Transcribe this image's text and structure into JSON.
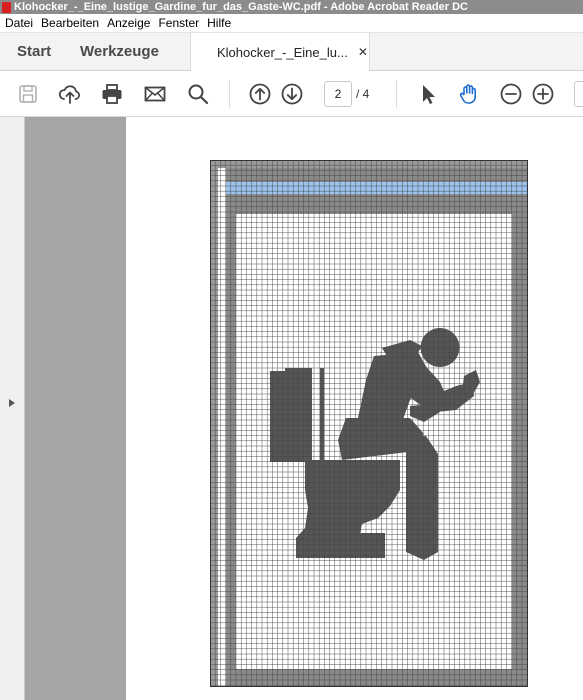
{
  "window": {
    "title": "Klohocker_-_Eine_lustige_Gardine_fur_das_Gaste-WC.pdf - Adobe Acrobat Reader DC"
  },
  "menu": [
    "Datei",
    "Bearbeiten",
    "Anzeige",
    "Fenster",
    "Hilfe"
  ],
  "tabs": {
    "start": "Start",
    "tools": "Werkzeuge",
    "document": "Klohocker_-_Eine_lu...",
    "close_symbol": "✕"
  },
  "toolbar": {
    "icons": [
      "save-icon",
      "upload-icon",
      "print-icon",
      "mail-icon",
      "search-icon",
      "page-up-icon",
      "page-down-icon",
      "select-cursor-icon",
      "hand-tool-icon",
      "zoom-out-icon",
      "zoom-in-icon"
    ],
    "current_page": "2",
    "page_total": "/ 4"
  },
  "colors": {
    "chart_fill": "#555555",
    "blue_band": "#9cc3ee",
    "grid_line": "#444444",
    "page_margin": "#a5a5a5",
    "hand_tool_active": "#1f6fd0"
  }
}
